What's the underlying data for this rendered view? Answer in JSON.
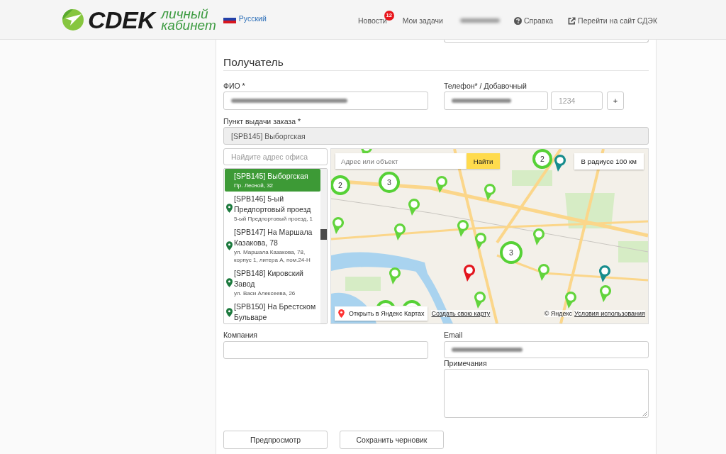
{
  "header": {
    "logo": {
      "wordmark": "CDEK",
      "tagline": [
        "личный",
        "кабинет"
      ]
    },
    "language": "Русский",
    "nav": [
      {
        "label": "Новости",
        "badge": "12"
      },
      {
        "label": "Мои задачи"
      }
    ],
    "user": {
      "redacted": true
    },
    "links": [
      {
        "kind": "help",
        "label": "Справка"
      },
      {
        "kind": "external",
        "label": "Перейти на сайт СДЭК"
      }
    ]
  },
  "recipient": {
    "heading": "Получатель",
    "name": {
      "label": "ФИО *",
      "value_redacted": true
    },
    "phone": {
      "label": "Телефон* / Добавочный",
      "value_redacted": true,
      "extension_placeholder": "1234",
      "add_button": "+"
    },
    "pickup_point": {
      "label": "Пункт выдачи заказа *",
      "value": "[SPB145] Выборгская"
    },
    "office_search": {
      "placeholder": "Найдите адрес офиса"
    },
    "offices": [
      {
        "name": "[SPB145] Выборгская",
        "address": "Пр. Лесной, 32",
        "selected": true
      },
      {
        "name": "[SPB146] 5-ый Предпортовый проезд",
        "address": "5-ый Предпортовый проезд, 1",
        "selected": false
      },
      {
        "name": "[SPB147] На Маршала Казакова, 78",
        "address": "ул. Маршала Казакова, 78, корпус 1, литера А, пом.24-Н",
        "selected": false
      },
      {
        "name": "[SPB148] Кировский Завод",
        "address": "ул. Васи Алексеева, 26",
        "selected": false
      },
      {
        "name": "[SPB150] На Брестском Бульваре",
        "selected": false
      }
    ],
    "map": {
      "search_placeholder": "Адрес или объект",
      "search_button": "Найти",
      "radius_button": "В радиусе 100 км",
      "open_link": "Открыть в Яндекс Картах",
      "create_link": "Создать свою карту",
      "copyright": "© Яндекс",
      "terms_link": "Условия использования",
      "markers": [
        {
          "kind": "cluster",
          "count": "2"
        },
        {
          "kind": "pin",
          "color": "#178d8d"
        },
        {
          "kind": "pin",
          "color": "#62d43c"
        },
        {
          "kind": "cluster",
          "count": "2"
        },
        {
          "kind": "cluster",
          "count": "3"
        },
        {
          "kind": "pin",
          "color": "#62d43c"
        },
        {
          "kind": "pin",
          "color": "#62d43c"
        },
        {
          "kind": "pin",
          "color": "#62d43c"
        },
        {
          "kind": "pin",
          "color": "#62d43c"
        },
        {
          "kind": "pin",
          "color": "#62d43c"
        },
        {
          "kind": "pin",
          "color": "#62d43c"
        },
        {
          "kind": "pin",
          "color": "#62d43c"
        },
        {
          "kind": "pin",
          "color": "#62d43c"
        },
        {
          "kind": "cluster",
          "count": "3"
        },
        {
          "kind": "pin",
          "color": "#62d43c"
        },
        {
          "kind": "pin",
          "color": "#e3161e"
        },
        {
          "kind": "pin",
          "color": "#62d43c"
        },
        {
          "kind": "pin",
          "color": "#178d8d"
        },
        {
          "kind": "pin",
          "color": "#62d43c"
        },
        {
          "kind": "pin",
          "color": "#62d43c"
        },
        {
          "kind": "pin",
          "color": "#62d43c"
        },
        {
          "kind": "cluster"
        },
        {
          "kind": "cluster"
        }
      ]
    },
    "company": {
      "label": "Компания"
    },
    "email": {
      "label": "Email",
      "value_redacted": true
    },
    "notes": {
      "label": "Примечания"
    }
  },
  "actions": [
    "Предпросмотр",
    "Сохранить черновик"
  ]
}
